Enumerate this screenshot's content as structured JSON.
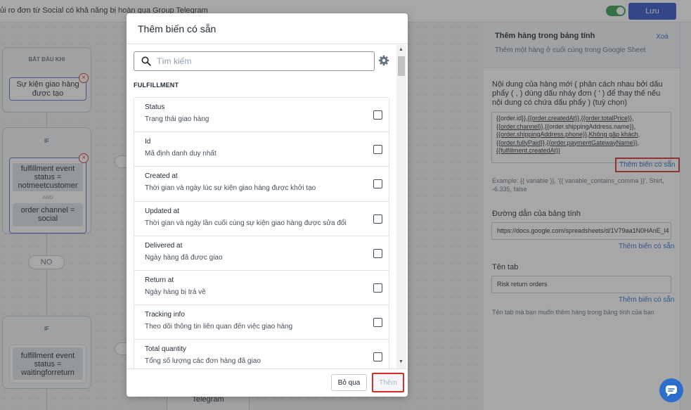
{
  "topbar": {
    "title": "ủi ro đơn từ Social có khả năng bị hoàn qua Group Telegram",
    "save_label": "Lưu"
  },
  "canvas": {
    "start_block": {
      "title": "BẮT ĐẦU KHI",
      "node": "Sự kiện giao hàng được tạo"
    },
    "if_block_1": {
      "title": "IF",
      "cond_1": "fulfillment event status = notmeetcustomer",
      "and_label": "AND",
      "cond_2": "order channel = social"
    },
    "no_pill": "NO",
    "if_block_2": {
      "title": "IF",
      "cond_1": "fulfillment event status = waitingforreturn"
    },
    "telegram_node": "Telegram"
  },
  "modal": {
    "title": "Thêm biến có sẵn",
    "search_placeholder": "Tìm kiếm",
    "section": "FULFILLMENT",
    "items": [
      {
        "name": "Status",
        "desc": "Trạng thái giao hàng"
      },
      {
        "name": "Id",
        "desc": "Mã định danh duy nhất"
      },
      {
        "name": "Created at",
        "desc": "Thời gian và ngày lúc sự kiện giao hàng được khởi tạo"
      },
      {
        "name": "Updated at",
        "desc": "Thời gian và ngày lần cuối cùng sự kiện giao hàng được sửa đổi"
      },
      {
        "name": "Delivered at",
        "desc": "Ngày hàng đã được giao"
      },
      {
        "name": "Return at",
        "desc": "Ngày hàng bị trả về"
      },
      {
        "name": "Tracking info",
        "desc": "Theo dõi thông tin liên quan đến việc giao hàng"
      },
      {
        "name": "Total quantity",
        "desc": "Tổng số lượng các đơn hàng đã giao"
      }
    ],
    "skip_label": "Bỏ qua",
    "add_label": "Thêm"
  },
  "panel": {
    "header_title": "Thêm hàng trong bảng tính",
    "header_sub": "Thêm một hàng ở cuối cùng trong Google Sheet",
    "delete_label": "Xoá",
    "content_label": "Nội dung của hàng mới ( phân cách nhau bởi dấu phẩy ( , ) dùng dấu nháy đơn ( ' ) để thay thế nếu nội dung có chứa dấu phẩy ) (tuỳ chọn)",
    "content_lines": [
      {
        "a": "{{order.id}},",
        "b": "{{order.createdAt}}",
        "c": ",",
        "d": "{{order.totalPrice}}",
        "e": ","
      },
      {
        "a": "",
        "b": "{{order.channel}}",
        "c": ",{{order.shippingAddress.name}},",
        "d": "",
        "e": ""
      },
      {
        "a": "",
        "b": "{{order.shippingAddress.phone}}",
        "c": ",",
        "d": "Không gặp khách",
        "e": ","
      },
      {
        "a": "",
        "b": "{{order.fullyPaid}}",
        "c": ",",
        "d": "{{order.paymentGatewayName}}",
        "e": ","
      },
      {
        "a": "",
        "b": "{{fulfillment.createdAt}}",
        "c": "",
        "d": "",
        "e": ""
      }
    ],
    "insert_var_label": "Thêm biến có sẵn",
    "example_text": "Example: {{ variable }}, '{{ variable_contains_comma }}', Shirt, -6.335, false",
    "sheet_url_label": "Đường dẫn của bảng tính",
    "sheet_url_value": "https://docs.google.com/spreadsheets/d/1V79aa1N0HAnE_l4",
    "tab_label": "Tên tab",
    "tab_value": "Risk return orders",
    "tab_help": "Tên tab mà bạn muốn thêm hàng trong bảng tính của bạn"
  }
}
